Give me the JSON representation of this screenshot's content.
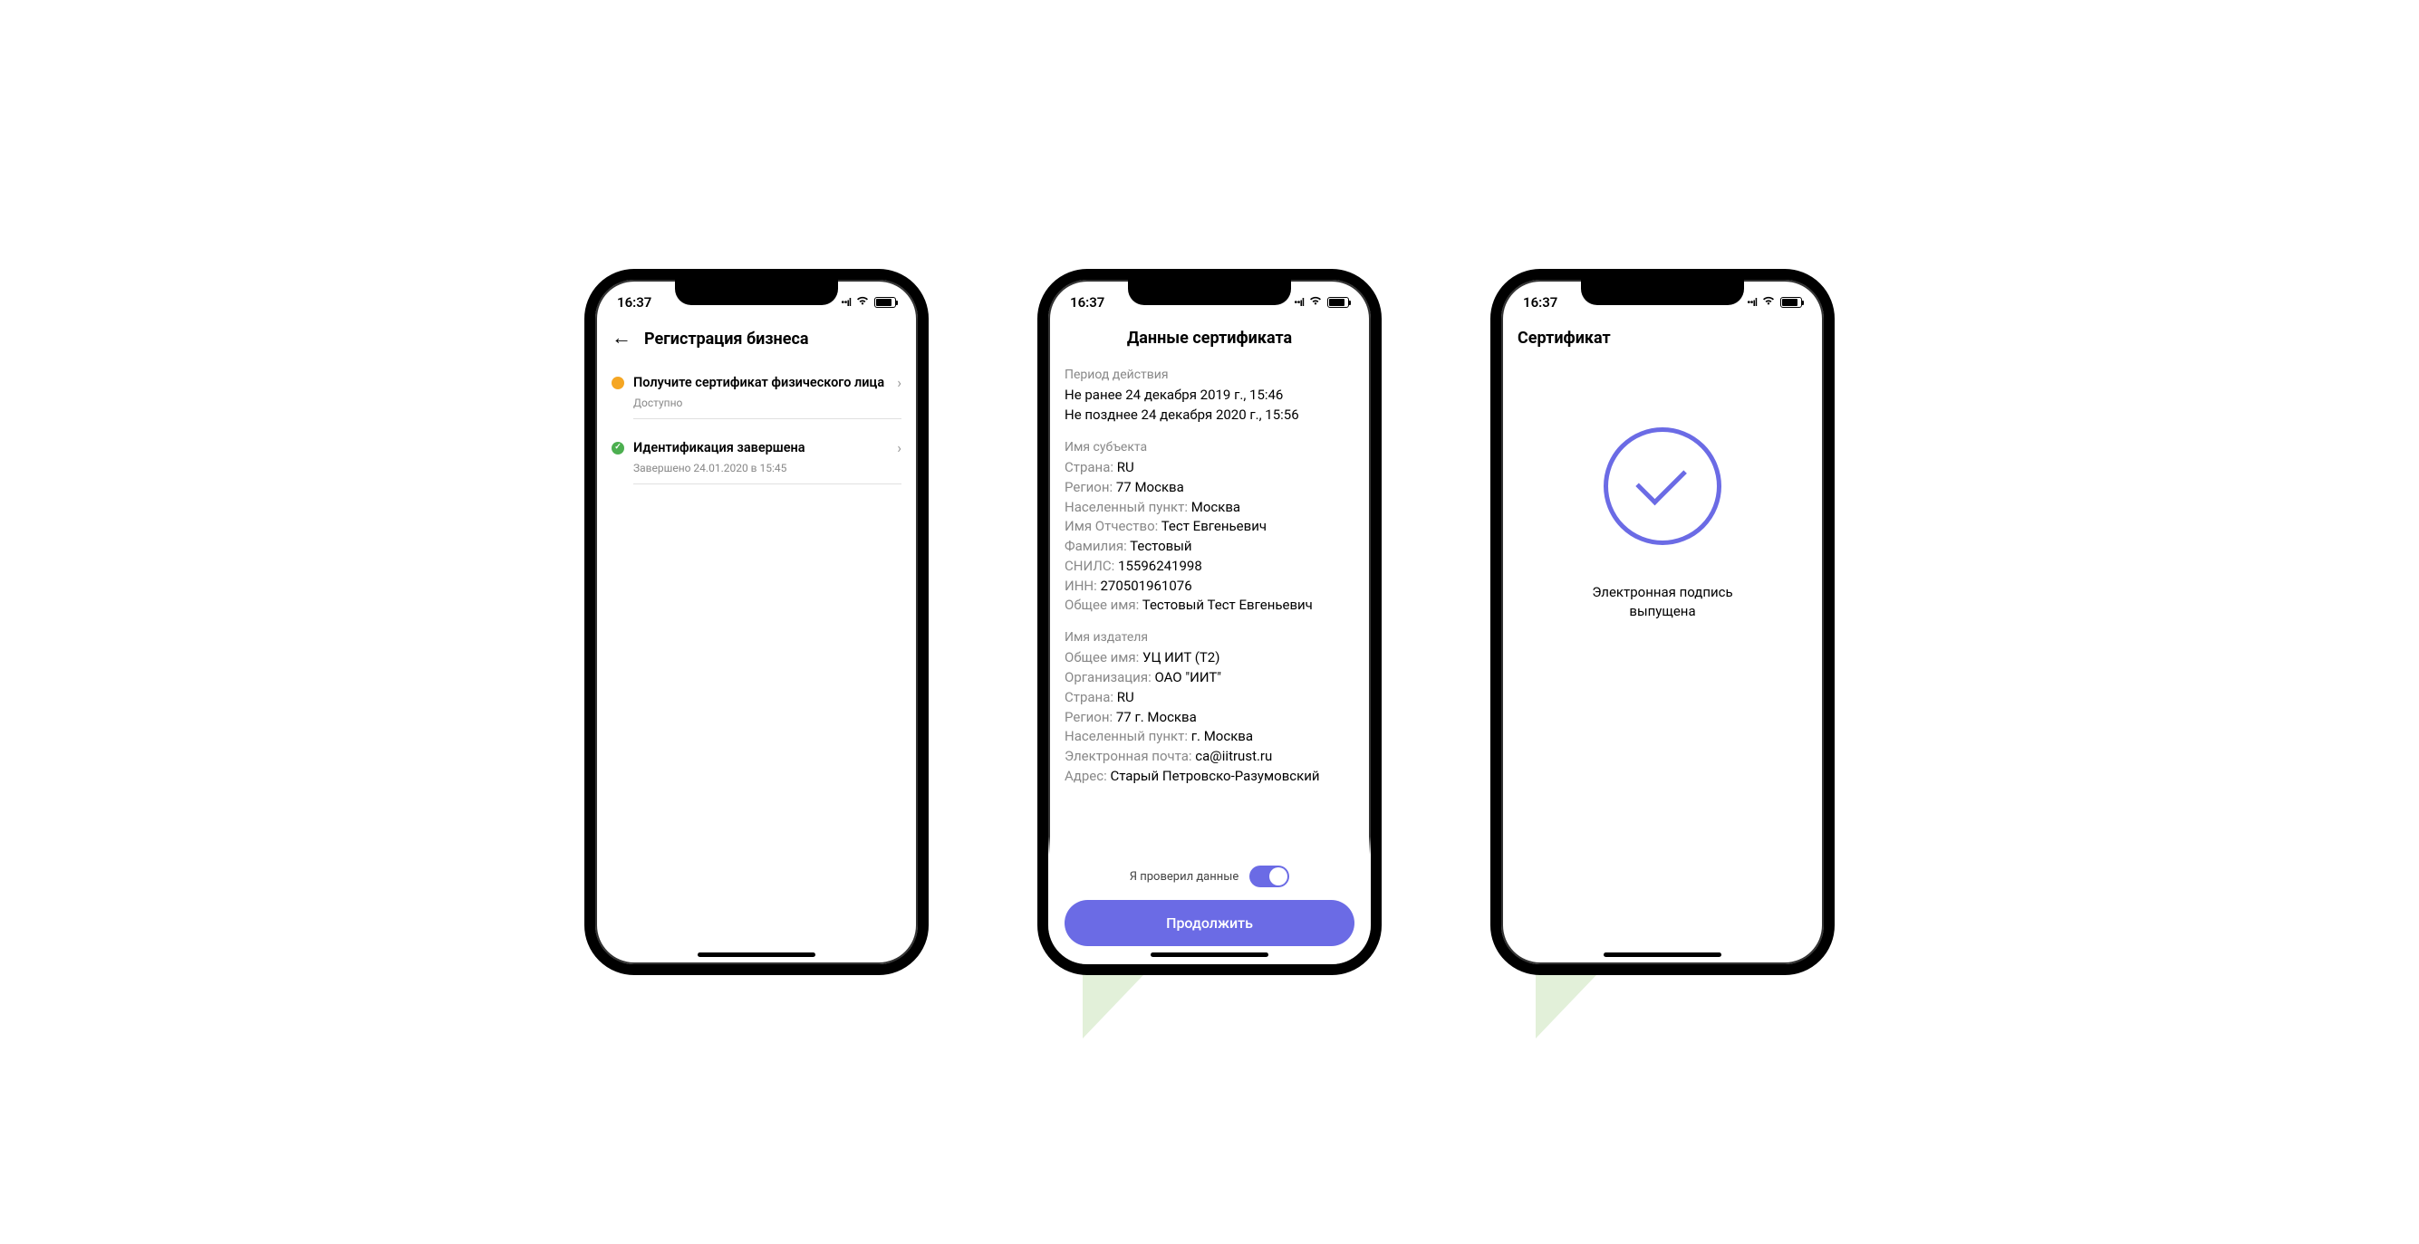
{
  "status_time": "16:37",
  "screen1": {
    "title": "Регистрация бизнеса",
    "items": [
      {
        "title": "Получите сертификат физического лица",
        "sub": "Доступно"
      },
      {
        "title": "Идентификация завершена",
        "sub": "Завершено 24.01.2020 в 15:45"
      }
    ]
  },
  "screen2": {
    "title": "Данные сертификата",
    "period_label": "Период действия",
    "period_from": "Не ранее 24 декабря 2019 г., 15:46",
    "period_to": "Не позднее 24 декабря 2020 г., 15:56",
    "subject_label": "Имя субъекта",
    "subject": {
      "country_k": "Страна:",
      "country_v": "RU",
      "region_k": "Регион:",
      "region_v": "77 Москва",
      "locality_k": "Населенный пункт:",
      "locality_v": "Москва",
      "name_k": "Имя Отчество:",
      "name_v": "Тест Евгеньевич",
      "surname_k": "Фамилия:",
      "surname_v": "Тестовый",
      "snils_k": "СНИЛС:",
      "snils_v": "15596241998",
      "inn_k": "ИНН:",
      "inn_v": "270501961076",
      "cn_k": "Общее имя:",
      "cn_v": "Тестовый Тест Евгеньевич"
    },
    "issuer_label": "Имя издателя",
    "issuer": {
      "cn_k": "Общее имя:",
      "cn_v": "УЦ ИИТ (Т2)",
      "org_k": "Организация:",
      "org_v": "ОАО \"ИИТ\"",
      "country_k": "Страна:",
      "country_v": "RU",
      "region_k": "Регион:",
      "region_v": "77 г. Москва",
      "locality_k": "Населенный пункт:",
      "locality_v": "г. Москва",
      "email_k": "Электронная почта:",
      "email_v": "ca@iitrust.ru",
      "addr_k": "Адрес:",
      "addr_v": "Старый Петровско-Разумовский"
    },
    "toggle_label": "Я проверил данные",
    "button": "Продолжить"
  },
  "screen3": {
    "title": "Сертификат",
    "message_l1": "Электронная подпись",
    "message_l2": "выпущена"
  }
}
